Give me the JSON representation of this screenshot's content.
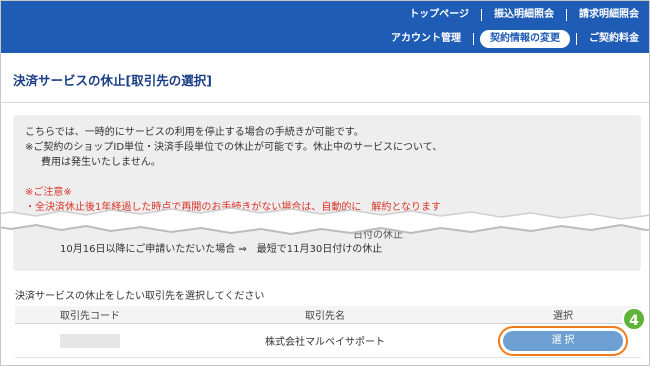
{
  "nav": {
    "row1": [
      "トップページ",
      "振込明細照会",
      "請求明細照会"
    ],
    "row2": [
      "アカウント管理",
      "契約情報の変更",
      "ご契約料金"
    ],
    "active": "契約情報の変更"
  },
  "page_title": "決済サービスの休止[取引先の選択]",
  "info": {
    "p1": "こちらでは、一時的にサービスの利用を停止する場合の手続きが可能です。",
    "p2": "※ご契約のショップID単位・決済手段単位での休止が可能です。休止中のサービスについて、",
    "p3": "費用は発生いたしません。",
    "caution_title": "※ご注意※",
    "caution_bullet": "・全決済休止後1年経過した時点で再開のお手続きがない場合は、自動的に　解約となります",
    "line_a": "日付の休止",
    "line_b": "10月16日以降にご申請いただいた場合 ⇒　最短で11月30日付けの休止"
  },
  "instruction": "決済サービスの休止をしたい取引先を選択してください",
  "table": {
    "headers": [
      "取引先コード",
      "取引先名",
      "選択"
    ],
    "rows": [
      {
        "code": "",
        "name": "株式会社マルペイサポート",
        "action": "選 択"
      }
    ]
  },
  "step_badge": "4",
  "colors": {
    "header": "#1f5cb6",
    "title": "#1a3e86",
    "caution": "#d9352b",
    "button": "#6d9fd2",
    "highlight": "#f07c1d",
    "badge": "#5fb336"
  }
}
